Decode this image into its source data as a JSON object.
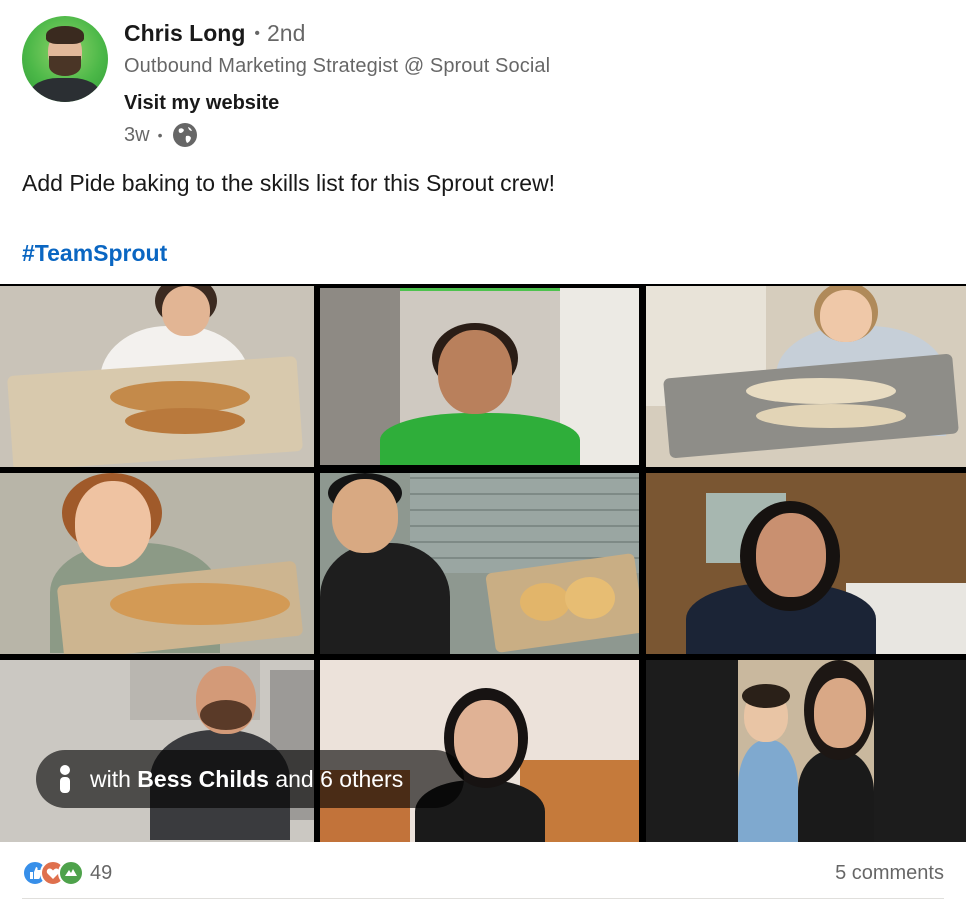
{
  "author": {
    "name": "Chris Long",
    "separator": "•",
    "degree": "2nd",
    "headline": "Outbound Marketing Strategist @ Sprout Social",
    "website_label": "Visit my website",
    "time_ago": "3w",
    "meta_separator": "•",
    "visibility_icon": "globe-icon"
  },
  "post": {
    "text": "Add Pide baking to the skills list for this Sprout crew!",
    "hashtag": "#TeamSprout"
  },
  "media": {
    "tag_prefix": "with ",
    "tag_person": "Bess Childs",
    "tag_suffix": " and 6 others",
    "tag_icon": "person-icon",
    "speaking_color": "#4ec24e"
  },
  "social": {
    "reaction_icons": [
      "like-icon",
      "love-icon",
      "support-icon"
    ],
    "reaction_count": "49",
    "comments": "5 comments"
  },
  "colors": {
    "link": "#0a66c2",
    "like": "#378fe9",
    "love": "#df704d",
    "support": "#4ea24b"
  }
}
